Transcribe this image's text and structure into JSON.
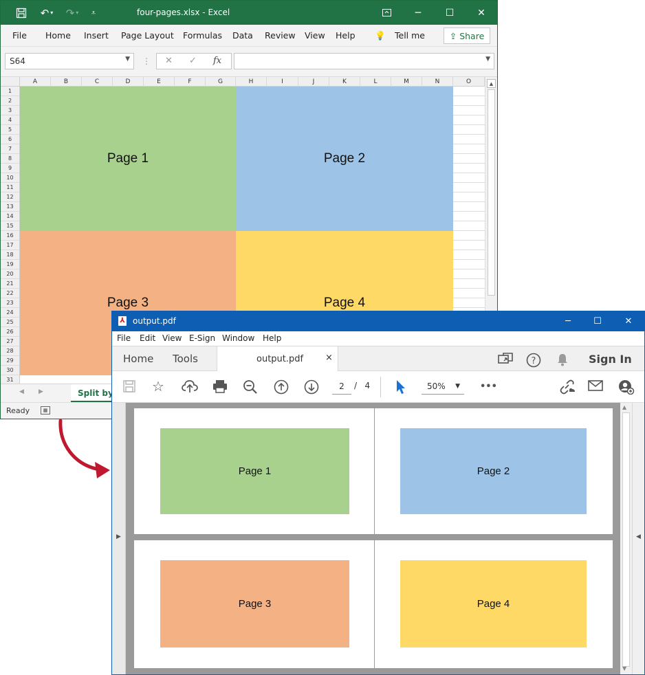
{
  "excel": {
    "title": "four-pages.xlsx  -  Excel",
    "menu": [
      "File",
      "Home",
      "Insert",
      "Page Layout",
      "Formulas",
      "Data",
      "Review",
      "View",
      "Help"
    ],
    "tell_me": "Tell me",
    "share": "Share",
    "name_box": "S64",
    "fx": "fx",
    "columns": [
      "A",
      "B",
      "C",
      "D",
      "E",
      "F",
      "G",
      "H",
      "I",
      "J",
      "K",
      "L",
      "M",
      "N",
      "O"
    ],
    "rows": [
      "1",
      "2",
      "3",
      "4",
      "5",
      "6",
      "7",
      "8",
      "9",
      "10",
      "11",
      "12",
      "13",
      "14",
      "15",
      "16",
      "17",
      "18",
      "19",
      "20",
      "21",
      "22",
      "23",
      "24",
      "25",
      "26",
      "27",
      "28",
      "29",
      "30",
      "31"
    ],
    "blocks": [
      {
        "label": "Page 1",
        "color": "#a9d18e"
      },
      {
        "label": "Page 2",
        "color": "#9dc3e6"
      },
      {
        "label": "Page 3",
        "color": "#f4b183"
      },
      {
        "label": "Page 4",
        "color": "#ffd966"
      }
    ],
    "sheet_tab": "Split by",
    "status": "Ready",
    "accent": "#217346"
  },
  "pdf": {
    "title": "output.pdf",
    "menu": [
      "File",
      "Edit",
      "View",
      "E-Sign",
      "Window",
      "Help"
    ],
    "tabs": {
      "home": "Home",
      "tools": "Tools",
      "doc": "output.pdf",
      "close": "×",
      "sign_in": "Sign In"
    },
    "toolbar": {
      "page_current": "2",
      "page_sep": "/",
      "page_total": "4",
      "zoom": "50%",
      "more": "•••"
    },
    "pages": [
      {
        "label": "Page 1",
        "color": "#a9d18e"
      },
      {
        "label": "Page 2",
        "color": "#9dc3e6"
      },
      {
        "label": "Page 3",
        "color": "#f4b183"
      },
      {
        "label": "Page 4",
        "color": "#ffd966"
      }
    ],
    "accent": "#0e5fb4"
  },
  "arrow_color": "#c0182e"
}
